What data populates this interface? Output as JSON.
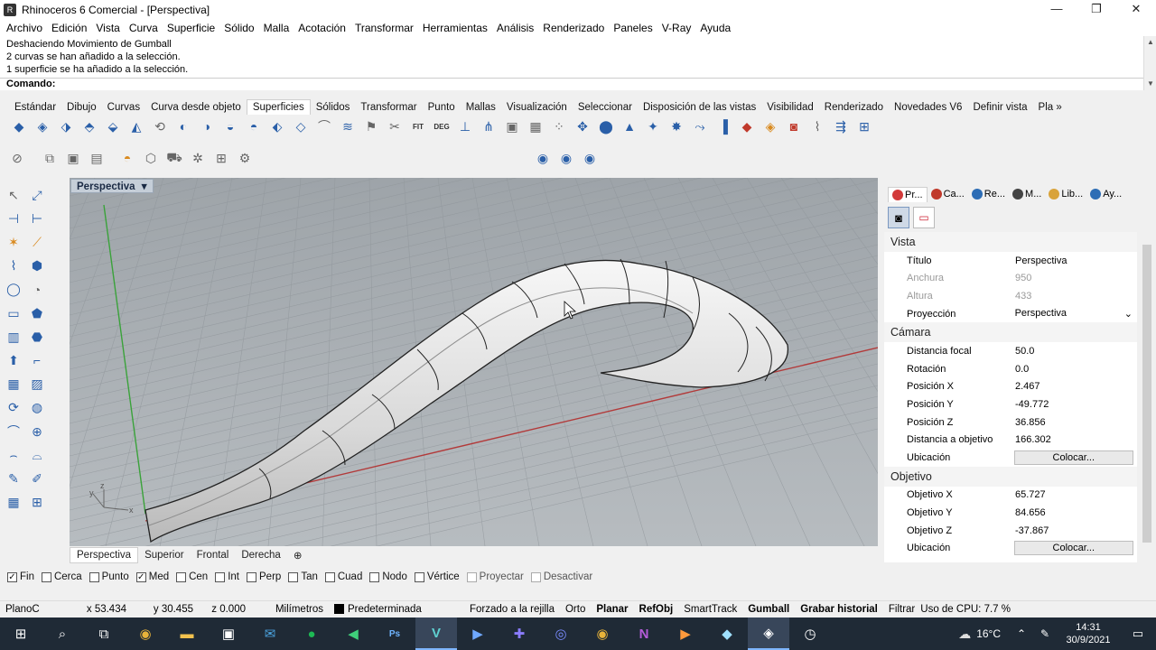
{
  "window": {
    "title": "Rhinoceros 6 Comercial - [Perspectiva]",
    "min": "—",
    "max": "❐",
    "close": "✕"
  },
  "menu": [
    "Archivo",
    "Edición",
    "Vista",
    "Curva",
    "Superficie",
    "Sólido",
    "Malla",
    "Acotación",
    "Transformar",
    "Herramientas",
    "Análisis",
    "Renderizado",
    "Paneles",
    "V-Ray",
    "Ayuda"
  ],
  "command": {
    "history": [
      "Deshaciendo Movimiento de Gumball",
      "2 curvas se han añadido a la selección.",
      "1 superficie se ha añadido a la selección."
    ],
    "prompt": "Comando:"
  },
  "toolbar_tabs": [
    "Estándar",
    "Dibujo",
    "Curvas",
    "Curva desde objeto",
    "Superficies",
    "Sólidos",
    "Transformar",
    "Punto",
    "Mallas",
    "Visualización",
    "Seleccionar",
    "Disposición de las vistas",
    "Visibilidad",
    "Renderizado",
    "Novedades V6",
    "Definir vista",
    "Pla »"
  ],
  "active_toolbar_tab": "Superficies",
  "toolbar_icons": {
    "fit": "FIT",
    "deg": "DEG"
  },
  "viewport": {
    "name": "Perspectiva",
    "dropdown": "▾",
    "axis_labels": {
      "z": "z",
      "y": "y",
      "x": "x"
    },
    "tabs": [
      "Perspectiva",
      "Superior",
      "Frontal",
      "Derecha"
    ],
    "add_tab": "⊕",
    "active_tab": "Perspectiva"
  },
  "panel": {
    "tabs": [
      {
        "label": "Pr...",
        "icon": "properties-icon",
        "color": "#d23a3a"
      },
      {
        "label": "Ca...",
        "icon": "layers-icon",
        "color": "#c0392b"
      },
      {
        "label": "Re...",
        "icon": "render-icon",
        "color": "#2d6db5"
      },
      {
        "label": "M...",
        "icon": "material-icon",
        "color": "#444"
      },
      {
        "label": "Lib...",
        "icon": "library-icon",
        "color": "#d9a33a"
      },
      {
        "label": "Ay...",
        "icon": "help-icon",
        "color": "#2d6db5"
      }
    ],
    "sections": {
      "vista": "Vista",
      "camara": "Cámara",
      "objetivo": "Objetivo"
    },
    "vista_rows": [
      {
        "k": "Título",
        "v": "Perspectiva",
        "dis": false
      },
      {
        "k": "Anchura",
        "v": "950",
        "dis": true
      },
      {
        "k": "Altura",
        "v": "433",
        "dis": true
      }
    ],
    "proyeccion": {
      "k": "Proyección",
      "v": "Perspectiva",
      "arrow": "⌄"
    },
    "camara_rows": [
      {
        "k": "Distancia focal",
        "v": "50.0"
      },
      {
        "k": "Rotación",
        "v": "0.0"
      },
      {
        "k": "Posición X",
        "v": "2.467"
      },
      {
        "k": "Posición Y",
        "v": "-49.772"
      },
      {
        "k": "Posición Z",
        "v": "36.856"
      },
      {
        "k": "Distancia a objetivo",
        "v": "166.302"
      }
    ],
    "ubicacion": {
      "k": "Ubicación",
      "v": "Colocar..."
    },
    "objetivo_rows": [
      {
        "k": "Objetivo X",
        "v": "65.727"
      },
      {
        "k": "Objetivo Y",
        "v": "84.656"
      },
      {
        "k": "Objetivo Z",
        "v": "-37.867"
      }
    ],
    "ubicacion2": {
      "k": "Ubicación",
      "v": "Colocar..."
    }
  },
  "osnaps": [
    {
      "label": "Fin",
      "checked": true,
      "disabled": false
    },
    {
      "label": "Cerca",
      "checked": false,
      "disabled": false
    },
    {
      "label": "Punto",
      "checked": false,
      "disabled": false
    },
    {
      "label": "Med",
      "checked": true,
      "disabled": false
    },
    {
      "label": "Cen",
      "checked": false,
      "disabled": false
    },
    {
      "label": "Int",
      "checked": false,
      "disabled": false
    },
    {
      "label": "Perp",
      "checked": false,
      "disabled": false
    },
    {
      "label": "Tan",
      "checked": false,
      "disabled": false
    },
    {
      "label": "Cuad",
      "checked": false,
      "disabled": false
    },
    {
      "label": "Nodo",
      "checked": false,
      "disabled": false
    },
    {
      "label": "Vértice",
      "checked": false,
      "disabled": false
    },
    {
      "label": "Proyectar",
      "checked": false,
      "disabled": true
    },
    {
      "label": "Desactivar",
      "checked": false,
      "disabled": true
    }
  ],
  "status": {
    "plane": "PlanoC",
    "x": "x 53.434",
    "y": "y 30.455",
    "z": "z 0.000",
    "units": "Milímetros",
    "layer": "Predeterminada",
    "grid": "Forzado a la rejilla",
    "ortho": "Orto",
    "planar": "Planar",
    "osnap": "RefObj",
    "smarttrack": "SmartTrack",
    "gumball": "Gumball",
    "history": "Grabar historial",
    "filter": "Filtrar",
    "cpu": "Uso de CPU: 7.7 %"
  },
  "taskbar": {
    "temperature": "16°C",
    "time": "14:31",
    "date": "30/9/2021"
  }
}
